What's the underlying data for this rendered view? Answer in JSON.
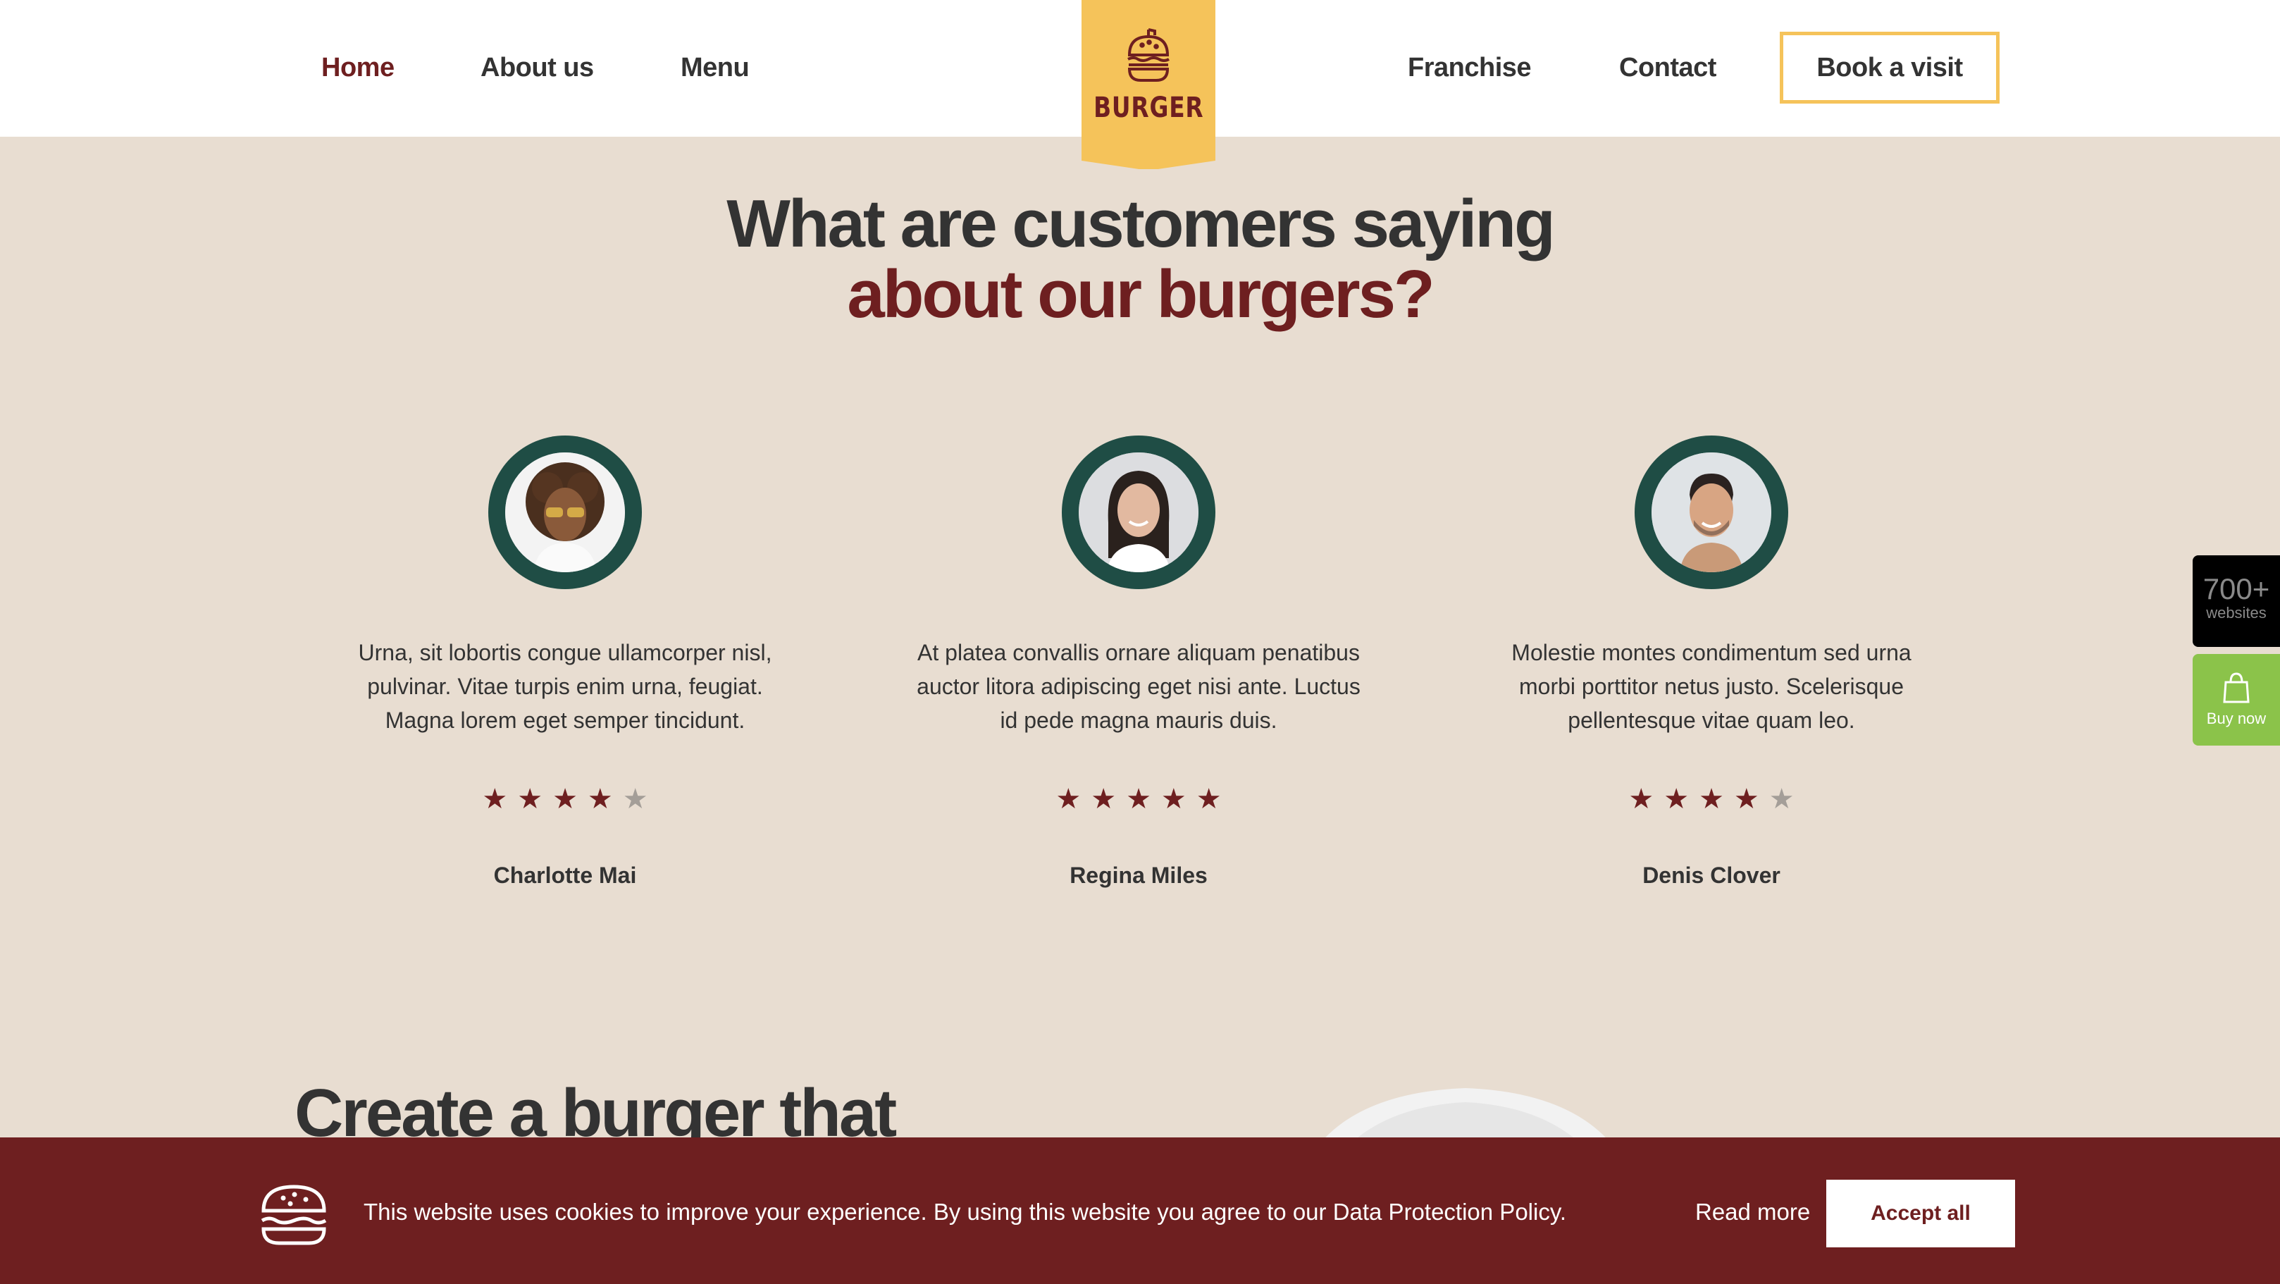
{
  "nav": {
    "links": [
      {
        "label": "Home",
        "active": true
      },
      {
        "label": "About us"
      },
      {
        "label": "Menu"
      },
      {
        "label": "Franchise"
      },
      {
        "label": "Contact"
      }
    ],
    "cta_label": "Book a visit"
  },
  "logo": {
    "text": "BURGER",
    "icon": "burger-icon"
  },
  "heading": {
    "line1": "What are customers saying",
    "line2": "about our burgers?"
  },
  "testimonials": [
    {
      "quote": "Urna, sit lobortis congue ullamcorper nisl, pulvinar. Vitae turpis enim urna, feugiat. Magna lorem eget semper tincidunt.",
      "rating": 4,
      "max_rating": 5,
      "name": "Charlotte Mai"
    },
    {
      "quote": "At platea convallis ornare aliquam penatibus auctor litora adipiscing eget nisi ante. Luctus id pede magna mauris duis.",
      "rating": 5,
      "max_rating": 5,
      "name": "Regina Miles"
    },
    {
      "quote": "Molestie montes condimentum sed urna morbi porttitor netus justo. Scelerisque pellentesque vitae quam leo.",
      "rating": 4,
      "max_rating": 5,
      "name": "Denis Clover"
    }
  ],
  "create_section": {
    "heading": "Create a burger that"
  },
  "side_widgets": {
    "websites_count": "700+",
    "websites_label": "websites",
    "buy_label": "Buy now"
  },
  "cookie_bar": {
    "text": "This website uses cookies to improve your experience. By using this website you agree to our Data Protection Policy.",
    "read_more": "Read more",
    "accept": "Accept all"
  },
  "colors": {
    "brand_red": "#6e1f20",
    "brand_yellow": "#f5c35a",
    "background": "#e8ddd1",
    "avatar_ring": "#1f4d45",
    "buy_green": "#8bc34a"
  }
}
